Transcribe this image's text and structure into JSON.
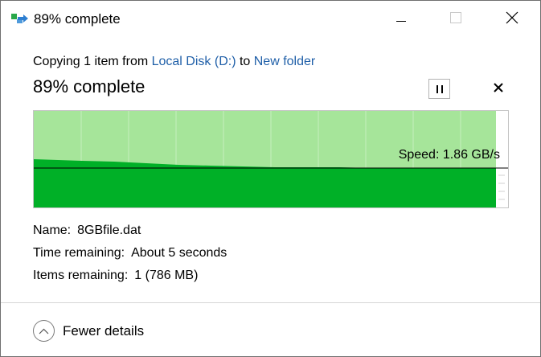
{
  "window": {
    "title": "89% complete",
    "icon": "file-copy-icon",
    "controls": [
      "minimize-icon",
      "maximize-icon",
      "close-icon"
    ]
  },
  "copy": {
    "prefix": "Copying 1 item from ",
    "source": "Local Disk (D:)",
    "middle": " to ",
    "destination": "New folder",
    "link_color": "#1f5fa8"
  },
  "progress": {
    "headline": "89% complete",
    "percent": 89
  },
  "controls": {
    "pause": "pause-icon",
    "cancel": "cancel-icon"
  },
  "graph": {
    "speed_label": "Speed: 1.86 GB/s",
    "fill_color": "#00b027",
    "background_fill": "#a6e59a"
  },
  "details": {
    "name_label": "Name:",
    "name_value": "8GBfile.dat",
    "time_label": "Time remaining:",
    "time_value": "About 5 seconds",
    "items_label": "Items remaining:",
    "items_value": "1 (786 MB)"
  },
  "footer": {
    "fewer_details": "Fewer details"
  }
}
